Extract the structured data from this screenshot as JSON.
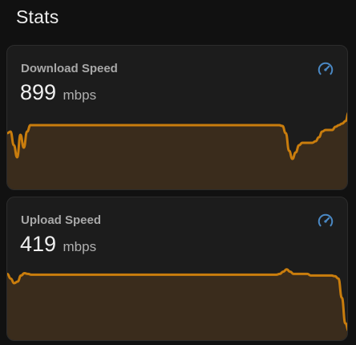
{
  "page": {
    "title": "Stats"
  },
  "colors": {
    "background": "#111111",
    "card": "#1c1c1c",
    "line": "#c97d0d",
    "fill": "#3a2c1c",
    "icon": "#4a88c4"
  },
  "cards": [
    {
      "name": "Download Speed",
      "value": "899",
      "unit": "mbps",
      "icon": "speedometer-icon",
      "history": [
        70,
        72,
        55,
        40,
        68,
        52,
        72,
        80,
        80,
        80,
        80,
        80,
        80,
        80,
        80,
        80,
        80,
        80,
        80,
        80,
        80,
        80,
        80,
        80,
        80,
        80,
        80,
        80,
        80,
        80,
        80,
        80,
        80,
        80,
        80,
        80,
        80,
        80,
        80,
        80,
        80,
        80,
        80,
        80,
        80,
        80,
        80,
        80,
        80,
        80,
        80,
        80,
        80,
        80,
        80,
        80,
        80,
        80,
        80,
        80,
        80,
        80,
        80,
        80,
        80,
        80,
        80,
        80,
        80,
        80,
        80,
        80,
        80,
        80,
        80,
        80,
        80,
        80,
        80,
        80,
        80,
        80,
        80,
        79,
        70,
        48,
        38,
        46,
        55,
        58,
        58,
        58,
        58,
        60,
        65,
        72,
        74,
        74,
        74,
        78,
        80,
        82,
        85,
        96
      ]
    },
    {
      "name": "Upload Speed",
      "value": "419",
      "unit": "mbps",
      "icon": "speedometer-icon",
      "history": [
        86,
        80,
        74,
        76,
        84,
        87,
        86,
        85,
        85,
        85,
        85,
        85,
        85,
        85,
        85,
        85,
        85,
        85,
        85,
        85,
        85,
        85,
        85,
        85,
        85,
        85,
        85,
        85,
        85,
        85,
        85,
        85,
        85,
        85,
        85,
        85,
        85,
        85,
        85,
        85,
        85,
        85,
        85,
        85,
        85,
        85,
        85,
        85,
        85,
        85,
        85,
        85,
        85,
        85,
        85,
        85,
        85,
        85,
        85,
        85,
        85,
        85,
        85,
        85,
        85,
        85,
        85,
        85,
        85,
        85,
        85,
        85,
        85,
        85,
        85,
        85,
        85,
        85,
        85,
        86,
        89,
        92,
        89,
        86,
        86,
        86,
        86,
        86,
        84,
        84,
        84,
        84,
        84,
        84,
        84,
        83,
        80,
        55,
        22,
        12
      ]
    }
  ]
}
